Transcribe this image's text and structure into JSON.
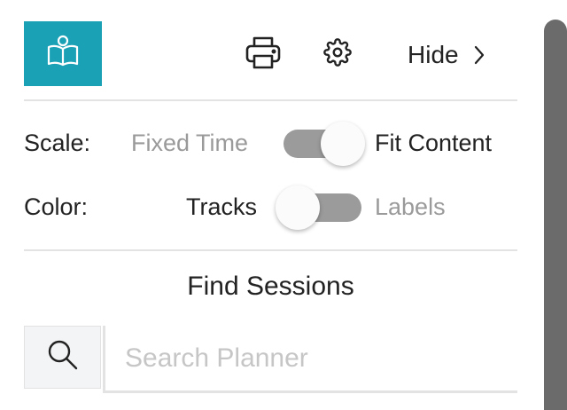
{
  "header": {
    "logo_icon": "book-reader-icon",
    "logo_color": "#1aa1b6",
    "print_icon": "printer-icon",
    "settings_icon": "gear-icon",
    "hide_label": "Hide",
    "hide_icon": "chevron-right-icon"
  },
  "scale": {
    "label": "Scale:",
    "option_left": "Fixed Time",
    "option_right": "Fit Content",
    "selected": "Fit Content"
  },
  "color": {
    "label": "Color:",
    "option_left": "Tracks",
    "option_right": "Labels",
    "selected": "Tracks"
  },
  "search": {
    "title": "Find Sessions",
    "icon": "search-icon",
    "placeholder": "Search Planner",
    "value": ""
  }
}
